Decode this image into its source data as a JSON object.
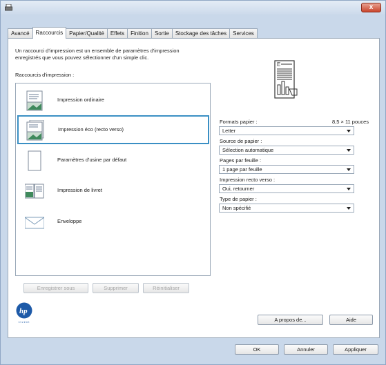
{
  "window": {
    "close_label": "x"
  },
  "tabs": [
    {
      "label": "Avancé",
      "active": false
    },
    {
      "label": "Raccourcis",
      "active": true
    },
    {
      "label": "Papier/Qualité",
      "active": false
    },
    {
      "label": "Effets",
      "active": false
    },
    {
      "label": "Finition",
      "active": false
    },
    {
      "label": "Sortie",
      "active": false
    },
    {
      "label": "Stockage des tâches",
      "active": false
    },
    {
      "label": "Services",
      "active": false
    }
  ],
  "intro": {
    "line1": "Un raccourci d'impression est un ensemble de paramètres d'impression",
    "line2": "enregistrés que vous pouvez sélectionner d'un simple clic."
  },
  "shortcuts": {
    "label": "Raccourcis d'impression :",
    "items": [
      {
        "label": "Impression ordinaire",
        "selected": false,
        "icon": "document-landscape-icon"
      },
      {
        "label": "Impression éco (recto verso)",
        "selected": true,
        "icon": "document-duplex-icon"
      },
      {
        "label": "Paramètres d'usine par défaut",
        "selected": false,
        "icon": "blank-page-icon"
      },
      {
        "label": "Impression de livret",
        "selected": false,
        "icon": "booklet-icon"
      },
      {
        "label": "Enveloppe",
        "selected": false,
        "icon": "envelope-icon"
      }
    ]
  },
  "settings": {
    "format_label": "Formats papier :",
    "format_size": "8,5 × 11 pouces",
    "format_value": "Letter",
    "source_label": "Source de papier :",
    "source_value": "Sélection automatique",
    "pages_label": "Pages par feuille :",
    "pages_value": "1 page par feuille",
    "duplex_label": "Impression recto verso :",
    "duplex_value": "Oui, retourner",
    "type_label": "Type de papier :",
    "type_value": "Non spécifié"
  },
  "buttons": {
    "save_as": "Enregistrer sous",
    "delete": "Supprimer",
    "reset": "Réinitialiser",
    "about": "A propos de...",
    "help": "Aide",
    "ok": "OK",
    "cancel": "Annuler",
    "apply": "Appliquer"
  },
  "branding": {
    "logo_text": "invent"
  }
}
